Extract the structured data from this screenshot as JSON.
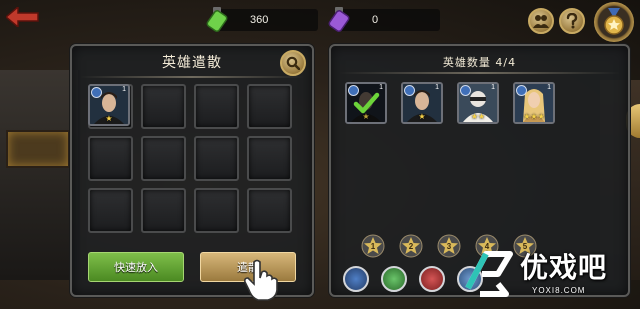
{
  "resources": {
    "green_value": "360",
    "purple_value": "0"
  },
  "left_panel": {
    "title": "英雄遣散",
    "grid_slots": 12,
    "hero": {
      "level": "1",
      "stars": "★"
    },
    "quick_add_label": "快速放入",
    "disband_label": "遣散"
  },
  "right_panel": {
    "title": "英雄数量 4/4",
    "heroes": [
      {
        "level": "1",
        "stars": "★"
      },
      {
        "level": "1",
        "stars": "★"
      },
      {
        "level": "1",
        "stars": "★★"
      },
      {
        "level": "1",
        "stars": "★★★"
      }
    ],
    "star_filters": [
      "1",
      "2",
      "3",
      "4",
      "5"
    ]
  },
  "watermark": {
    "text": "优戏吧",
    "url": "YOXI8.COM"
  },
  "colors": {
    "gold_accent": "#c8aa63",
    "green_button": "#5f9f30",
    "gold_button": "#b8975a",
    "panel_bg": "#1e2022"
  },
  "icons": {
    "back": "back-arrow-icon",
    "green_resource": "green-potion-icon",
    "purple_resource": "purple-potion-icon",
    "friends": "friends-icon",
    "help": "question-icon",
    "medal": "medal-icon",
    "search": "search-icon",
    "pointer": "hand-pointer-icon"
  }
}
